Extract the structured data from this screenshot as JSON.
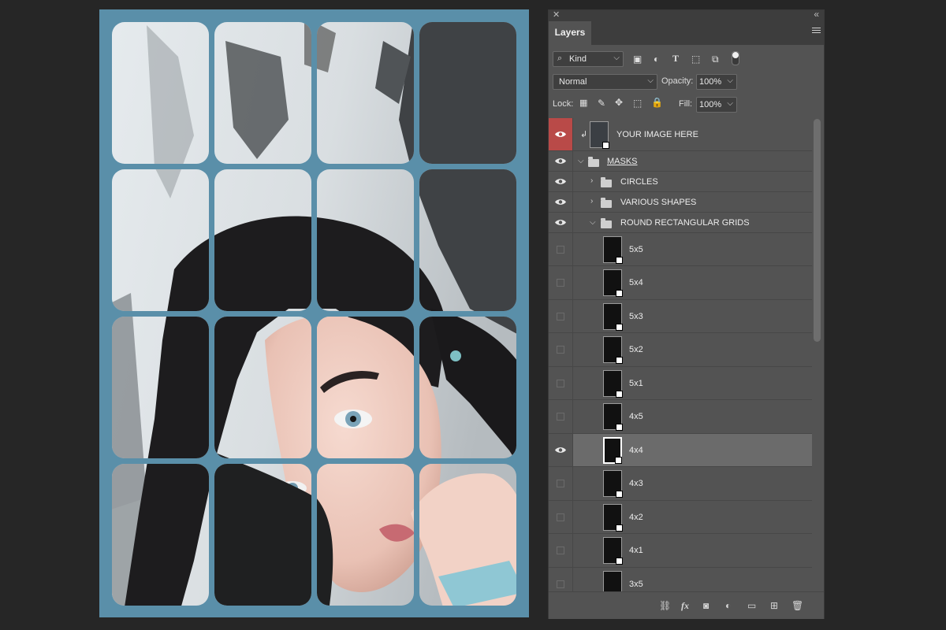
{
  "canvas": {
    "background_color": "#5a8fa9",
    "grid_layout": "4 columns x 4 rows of rounded rectangle masks"
  },
  "panel": {
    "tab_label": "Layers",
    "filter": {
      "value": "Kind"
    },
    "blend_mode": {
      "value": "Normal"
    },
    "opacity": {
      "label": "Opacity:",
      "value": "100%"
    },
    "lock": {
      "label": "Lock:"
    },
    "fill": {
      "label": "Fill:",
      "value": "100%"
    },
    "layers": [
      {
        "name": "YOUR IMAGE HERE",
        "type": "image",
        "visible": true,
        "highlight": "#b94a48"
      },
      {
        "name": "MASKS",
        "type": "group",
        "visible": true,
        "expanded": true
      },
      {
        "name": "CIRCLES",
        "type": "group",
        "visible": true,
        "expanded": false
      },
      {
        "name": "VARIOUS SHAPES",
        "type": "group",
        "visible": true,
        "expanded": false
      },
      {
        "name": "ROUND RECTANGULAR GRIDS",
        "type": "group",
        "visible": true,
        "expanded": true
      },
      {
        "name": "5x5",
        "type": "layer",
        "visible": false
      },
      {
        "name": "5x4",
        "type": "layer",
        "visible": false
      },
      {
        "name": "5x3",
        "type": "layer",
        "visible": false
      },
      {
        "name": "5x2",
        "type": "layer",
        "visible": false
      },
      {
        "name": "5x1",
        "type": "layer",
        "visible": false
      },
      {
        "name": "4x5",
        "type": "layer",
        "visible": false
      },
      {
        "name": "4x4",
        "type": "layer",
        "visible": true,
        "selected": true
      },
      {
        "name": "4x3",
        "type": "layer",
        "visible": false
      },
      {
        "name": "4x2",
        "type": "layer",
        "visible": false
      },
      {
        "name": "4x1",
        "type": "layer",
        "visible": false
      },
      {
        "name": "3x5",
        "type": "layer",
        "visible": false
      }
    ],
    "footer_icons": [
      "link-icon",
      "fx-icon",
      "mask-icon",
      "adjustment-icon",
      "folder-icon",
      "new-layer-icon",
      "trash-icon"
    ]
  }
}
